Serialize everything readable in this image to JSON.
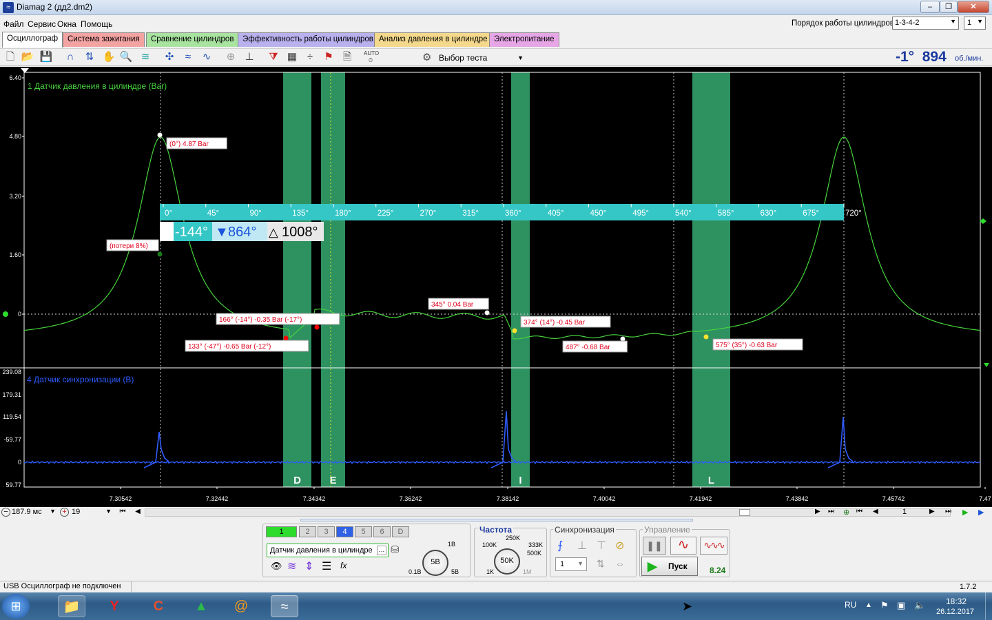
{
  "window": {
    "title": "Diamag 2 (дд2.dm2)"
  },
  "menu": [
    "Файл",
    "Сервис",
    "Окна",
    "Помощь"
  ],
  "cylinder_order": {
    "label": "Порядок работы цилиндров",
    "value": "1-3-4-2",
    "cylinder": "1"
  },
  "tabs": [
    {
      "label": "Осциллограф",
      "color": "#ffffff"
    },
    {
      "label": "Система зажигания",
      "color": "#f4a3a3"
    },
    {
      "label": "Сравнение цилиндров",
      "color": "#a8e3a0"
    },
    {
      "label": "Эффективность работы цилиндров",
      "color": "#b9b0ee"
    },
    {
      "label": "Анализ давления в цилиндре",
      "color": "#f4d98c"
    },
    {
      "label": "Электропитание",
      "color": "#e6a6e6"
    }
  ],
  "toolbar": {
    "test_select": "Выбор теста",
    "auto_label": "AUTO"
  },
  "readout": {
    "angle": "-1°",
    "rpm": "894",
    "rpm_unit": "об./мин."
  },
  "plot": {
    "channel1_label": "1 Датчик давления в цилиндре (Bar)",
    "channel4_label": "4 Датчик синхронизации (В)",
    "y1_ticks": [
      "6.40",
      "4.80",
      "3.20",
      "1.60",
      "0"
    ],
    "y4_ticks": [
      "239.08",
      "179.31",
      "119.54",
      "-59.77",
      "0",
      "59.77"
    ],
    "x_ticks": [
      "7.30542",
      "7.32442",
      "7.34342",
      "7.36242",
      "7.38142",
      "7.40042",
      "7.41942",
      "7.43842",
      "7.45742",
      "7.47"
    ],
    "degree_ticks": [
      "0°",
      "45°",
      "90°",
      "135°",
      "180°",
      "225°",
      "270°",
      "315°",
      "360°",
      "405°",
      "450°",
      "495°",
      "540°",
      "585°",
      "630°",
      "675°",
      "720°"
    ],
    "cursor_box": {
      "angle": "-144°",
      "filter": "864°",
      "delta": "1008°"
    },
    "zones": [
      "D",
      "E",
      "I",
      "L"
    ],
    "annotations": [
      "(0°) 4.87 Bar",
      "(потери 8%)",
      "166° (-14°) -0.35 Bar (-17°)",
      "133° (-47°) -0.65 Bar (-12°)",
      "345° 0.04 Bar",
      "374° (14°) -0.45 Bar",
      "487° -0.68 Bar",
      "575° (35°) -0.63 Bar"
    ],
    "colors": {
      "pressure": "#46d33c",
      "sync": "#2f5cff",
      "zone": "#2e9160",
      "degree_bar": "#35c6c6",
      "annotation": "#e0001b"
    }
  },
  "scroll": {
    "timebase": "187.9 мс",
    "zoom": "19",
    "page": "1"
  },
  "channels": {
    "buttons": [
      "1",
      "2",
      "3",
      "4",
      "5",
      "6",
      "D"
    ],
    "active": "1",
    "selected": "4",
    "sensor": "Датчик давления в цилиндре"
  },
  "range": {
    "value": "5В",
    "min": "0.1В",
    "max": "5В",
    "top": "1В"
  },
  "frequency": {
    "title": "Частота",
    "value": "50K",
    "labels": [
      "100K",
      "250K",
      "333K",
      "500K",
      "1K",
      "1M"
    ]
  },
  "sync": {
    "title": "Синхронизация",
    "value": "1"
  },
  "control": {
    "title": "Управление",
    "start": "Пуск",
    "value": "8.24"
  },
  "status": {
    "text": "USB Осциллограф не подключен",
    "version": "1.7.2"
  },
  "taskbar": {
    "lang": "RU",
    "time": "18:32",
    "date": "26.12.2017"
  }
}
